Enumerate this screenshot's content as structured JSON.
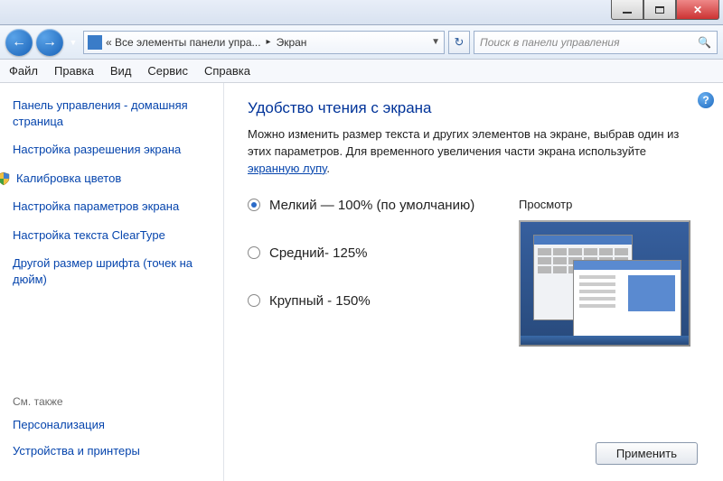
{
  "titlebar": {
    "minimize": "_",
    "maximize": "□",
    "close": "✕"
  },
  "nav": {
    "back": "←",
    "forward": "→",
    "breadcrumb_prefix": "«",
    "breadcrumb_1": "Все элементы панели упра...",
    "breadcrumb_2": "Экран",
    "refresh": "↻",
    "search_placeholder": "Поиск в панели управления"
  },
  "menu": {
    "file": "Файл",
    "edit": "Правка",
    "view": "Вид",
    "service": "Сервис",
    "help": "Справка"
  },
  "sidebar": {
    "home": "Панель управления - домашняя страница",
    "resolution": "Настройка разрешения экрана",
    "calibration": "Калибровка цветов",
    "display_params": "Настройка параметров экрана",
    "cleartype": "Настройка текста ClearType",
    "font_size": "Другой размер шрифта (точек на дюйм)",
    "see_also": "См. также",
    "personalization": "Персонализация",
    "devices": "Устройства и принтеры"
  },
  "main": {
    "heading": "Удобство чтения с экрана",
    "desc_1": "Можно изменить размер текста и других элементов на экране, выбрав один из этих параметров. Для временного увеличения части экрана используйте ",
    "magnifier_link": "экранную лупу",
    "desc_end": ".",
    "options": {
      "small": "Мелкий — 100% (по умолчанию)",
      "medium": "Средний- 125%",
      "large": "Крупный - 150%"
    },
    "preview_label": "Просмотр",
    "apply": "Применить",
    "help": "?"
  }
}
